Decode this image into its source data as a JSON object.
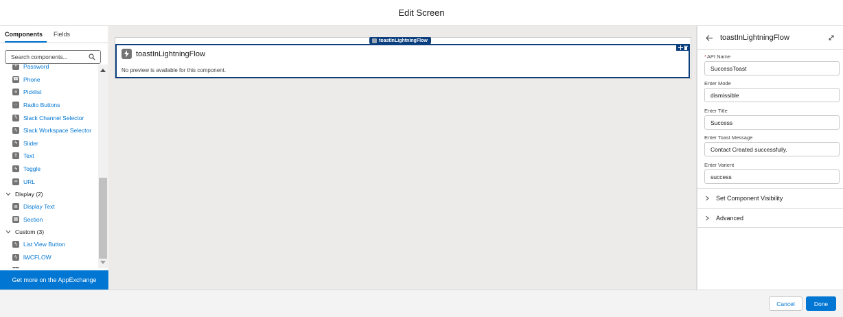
{
  "header": {
    "title": "Edit Screen"
  },
  "left_panel": {
    "tabs": [
      {
        "label": "Components",
        "active": true
      },
      {
        "label": "Fields",
        "active": false
      }
    ],
    "search": {
      "placeholder": "Search components..."
    },
    "items": [
      {
        "label": "Password",
        "icon": "password-icon"
      },
      {
        "label": "Phone",
        "icon": "phone-icon"
      },
      {
        "label": "Picklist",
        "icon": "picklist-icon"
      },
      {
        "label": "Radio Buttons",
        "icon": "radio-icon"
      },
      {
        "label": "Slack Channel Selector",
        "icon": "lightning-icon"
      },
      {
        "label": "Slack Workspace Selector",
        "icon": "lightning-icon"
      },
      {
        "label": "Slider",
        "icon": "lightning-icon"
      },
      {
        "label": "Text",
        "icon": "text-icon"
      },
      {
        "label": "Toggle",
        "icon": "lightning-icon"
      },
      {
        "label": "URL",
        "icon": "link-icon"
      }
    ],
    "display_group": {
      "label": "Display (2)",
      "items": [
        {
          "label": "Display Text",
          "icon": "display-text-icon"
        },
        {
          "label": "Section",
          "icon": "section-icon"
        }
      ]
    },
    "custom_group": {
      "label": "Custom (3)",
      "items": [
        {
          "label": "List View Button",
          "icon": "lightning-icon"
        },
        {
          "label": "lWCFLOW",
          "icon": "lightning-icon"
        },
        {
          "label": "toastInLightningFlow",
          "icon": "lightning-icon"
        }
      ]
    },
    "appexchange_label": "Get more on the AppExchange"
  },
  "canvas": {
    "chip_label": "toastInLightningFlow",
    "component": {
      "name": "toastInLightningFlow",
      "description": "No preview is available for this component."
    }
  },
  "right_panel": {
    "title": "toastInLightningFlow",
    "fields": [
      {
        "label": "API Name",
        "required": true,
        "value": "SuccessToast"
      },
      {
        "label": "Enter Mode",
        "required": false,
        "value": "dismissible"
      },
      {
        "label": "Enter Title",
        "required": false,
        "value": "Success"
      },
      {
        "label": "Enter Toast Message",
        "required": false,
        "value": "Contact Created successfully."
      },
      {
        "label": "Enter Varient",
        "required": false,
        "value": "success"
      }
    ],
    "sections": [
      {
        "label": "Set Component Visibility"
      },
      {
        "label": "Advanced"
      }
    ]
  },
  "footer": {
    "cancel_label": "Cancel",
    "done_label": "Done"
  },
  "colors": {
    "brand": "#0176d3",
    "selection": "#0b3f7e",
    "canvas": "#ecebea",
    "icon_gray": "#747474"
  }
}
